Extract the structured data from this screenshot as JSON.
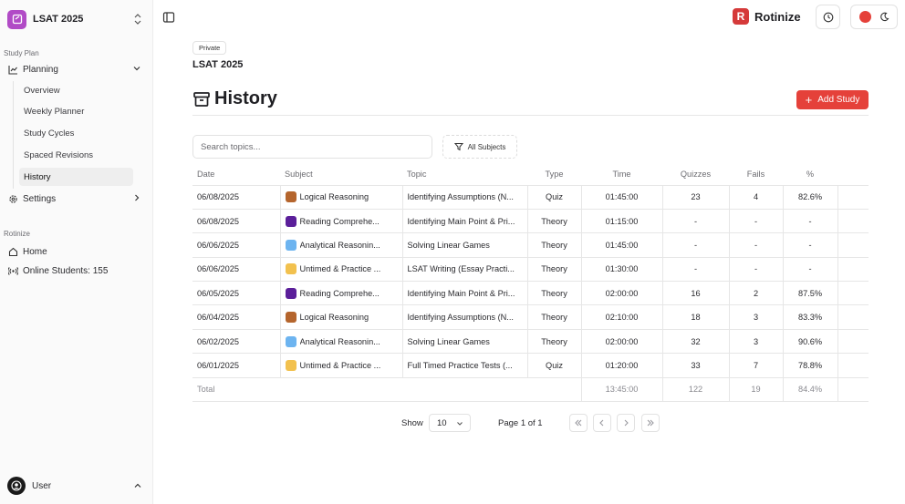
{
  "sidebar": {
    "workspace": {
      "name": "LSAT 2025"
    },
    "groups": [
      {
        "label": "Study Plan"
      },
      {
        "label": "Rotinize"
      }
    ],
    "planning": {
      "label": "Planning",
      "items": [
        {
          "label": "Overview"
        },
        {
          "label": "Weekly Planner"
        },
        {
          "label": "Study Cycles"
        },
        {
          "label": "Spaced Revisions"
        },
        {
          "label": "History",
          "active": true
        }
      ]
    },
    "settings": {
      "label": "Settings"
    },
    "home": {
      "label": "Home"
    },
    "online": {
      "label": "Online Students: 155"
    },
    "user": {
      "label": "User"
    }
  },
  "header": {
    "brand_letter": "R",
    "brand_name": "Rotinize",
    "accent_color": "#e5413a"
  },
  "plan": {
    "visibility": "Private",
    "title": "LSAT 2025"
  },
  "page": {
    "title": "History",
    "add_button": "Add Study"
  },
  "filters": {
    "search_placeholder": "Search topics...",
    "subjects_label": "All Subjects"
  },
  "table": {
    "headers": [
      "Date",
      "Subject",
      "Topic",
      "Type",
      "Time",
      "Quizzes",
      "Fails",
      "%"
    ],
    "rows": [
      {
        "date": "06/08/2025",
        "subject": "Logical Reasoning",
        "color": "#b5652d",
        "topic": "Identifying Assumptions (N...",
        "type": "Quiz",
        "time": "01:45:00",
        "quizzes": "23",
        "fails": "4",
        "pct": "82.6%"
      },
      {
        "date": "06/08/2025",
        "subject": "Reading Comprehe...",
        "color": "#5b1f9a",
        "topic": "Identifying Main Point & Pri...",
        "type": "Theory",
        "time": "01:15:00",
        "quizzes": "-",
        "fails": "-",
        "pct": "-"
      },
      {
        "date": "06/06/2025",
        "subject": "Analytical Reasonin...",
        "color": "#6db4f0",
        "topic": "Solving Linear Games",
        "type": "Theory",
        "time": "01:45:00",
        "quizzes": "-",
        "fails": "-",
        "pct": "-"
      },
      {
        "date": "06/06/2025",
        "subject": "Untimed & Practice ...",
        "color": "#f2c14e",
        "topic": "LSAT Writing (Essay Practi...",
        "type": "Theory",
        "time": "01:30:00",
        "quizzes": "-",
        "fails": "-",
        "pct": "-"
      },
      {
        "date": "06/05/2025",
        "subject": "Reading Comprehe...",
        "color": "#5b1f9a",
        "topic": "Identifying Main Point & Pri...",
        "type": "Theory",
        "time": "02:00:00",
        "quizzes": "16",
        "fails": "2",
        "pct": "87.5%"
      },
      {
        "date": "06/04/2025",
        "subject": "Logical Reasoning",
        "color": "#b5652d",
        "topic": "Identifying Assumptions (N...",
        "type": "Theory",
        "time": "02:10:00",
        "quizzes": "18",
        "fails": "3",
        "pct": "83.3%"
      },
      {
        "date": "06/02/2025",
        "subject": "Analytical Reasonin...",
        "color": "#6db4f0",
        "topic": "Solving Linear Games",
        "type": "Theory",
        "time": "02:00:00",
        "quizzes": "32",
        "fails": "3",
        "pct": "90.6%"
      },
      {
        "date": "06/01/2025",
        "subject": "Untimed & Practice ...",
        "color": "#f2c14e",
        "topic": "Full Timed Practice Tests (...",
        "type": "Quiz",
        "time": "01:20:00",
        "quizzes": "33",
        "fails": "7",
        "pct": "78.8%"
      }
    ],
    "total": {
      "label": "Total",
      "time": "13:45:00",
      "quizzes": "122",
      "fails": "19",
      "pct": "84.4%"
    }
  },
  "pagination": {
    "show_label": "Show",
    "page_size": "10",
    "page_info": "Page 1 of 1"
  }
}
